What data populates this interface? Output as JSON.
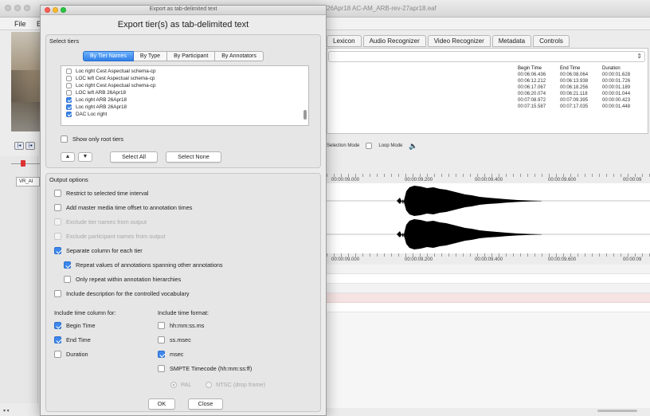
{
  "background_app": {
    "window_title": "26Apr18 AC-AM_ARB-rev-27apr18.eaf",
    "menu": {
      "file": "File",
      "edit": "E"
    },
    "tabs": [
      "Lexicon",
      "Audio Recognizer",
      "Video Recognizer",
      "Metadata",
      "Controls"
    ],
    "grid_headers": [
      "Begin Time",
      "End Time",
      "Duration"
    ],
    "grid_rows": [
      [
        "00:06:06.436",
        "00:06:08.064",
        "00:00:01.628"
      ],
      [
        "00:06:12.212",
        "00:06:13.938",
        "00:00:01.726"
      ],
      [
        "00:06:17.067",
        "00:06:18.256",
        "00:00:01.189"
      ],
      [
        "00:06:20.074",
        "00:06:21.118",
        "00:00:01.044"
      ],
      [
        "00:07:08.972",
        "00:07:09.395",
        "00:00:00.423"
      ],
      [
        "00:07:15.587",
        "00:07:17.035",
        "00:00:01.448"
      ]
    ],
    "selection_mode": "Selection Mode",
    "loop_mode": "Loop Mode",
    "tier_label": "VR_AI",
    "ruler_labels": [
      "00:00:09.000",
      "00:00:09.200",
      "00:00:09.400",
      "00:00:09.600",
      "00:00:09"
    ],
    "speaker_icon": "speaker-icon"
  },
  "dialog": {
    "window_title": "Export as tab-delimited text",
    "heading": "Export tier(s) as tab-delimited text",
    "select_tiers": {
      "title": "Select tiers",
      "tabs": [
        "By Tier Names",
        "By Type",
        "By Participant",
        "By Annotators"
      ],
      "active_tab": "By Tier Names",
      "tiers": [
        {
          "label": "Loc right Cest Aspectual schema-cp",
          "checked": false
        },
        {
          "label": "LOC left Cest Aspectual schema-cp",
          "checked": false
        },
        {
          "label": "Loc right Cest Aspectual schema-cp",
          "checked": false
        },
        {
          "label": "LOC left ARB 26Apr18",
          "checked": false
        },
        {
          "label": "Loc right ARB 26Apr18",
          "checked": true
        },
        {
          "label": "Loc right ARB 26Apr18",
          "checked": true
        },
        {
          "label": "DAC Loc right",
          "checked": true
        }
      ],
      "show_only_root_tiers": {
        "label": "Show only root tiers",
        "checked": false
      },
      "move_up": "▲",
      "move_down": "▼",
      "select_all": "Select All",
      "select_none": "Select None"
    },
    "output_options": {
      "title": "Output options",
      "options": [
        {
          "label": "Restrict to selected time interval",
          "checked": false,
          "enabled": true
        },
        {
          "label": "Add master media time offset to annotation times",
          "checked": false,
          "enabled": true
        },
        {
          "label": "Exclude tier names from output",
          "checked": false,
          "enabled": false
        },
        {
          "label": "Exclude participant names from output",
          "checked": false,
          "enabled": false
        },
        {
          "label": "Separate column for each tier",
          "checked": true,
          "enabled": true
        },
        {
          "label": "Repeat values of annotations spanning other annotations",
          "checked": true,
          "enabled": true
        },
        {
          "label": "Only repeat within annotation hierarchies",
          "checked": false,
          "enabled": true
        },
        {
          "label": "Include description for the controlled vocabulary",
          "checked": false,
          "enabled": true
        }
      ],
      "time_columns_title": "Include time column for:",
      "time_columns": [
        {
          "label": "Begin Time",
          "checked": true
        },
        {
          "label": "End Time",
          "checked": true
        },
        {
          "label": "Duration",
          "checked": false
        }
      ],
      "time_formats_title": "Include time format:",
      "time_formats": [
        {
          "label": "hh:mm:ss.ms",
          "checked": false
        },
        {
          "label": "ss.msec",
          "checked": false
        },
        {
          "label": "msec",
          "checked": true
        },
        {
          "label": "SMPTE Timecode (hh:mm:ss:ff)",
          "checked": false
        }
      ],
      "frame_rates": [
        {
          "label": "PAL",
          "selected": true
        },
        {
          "label": "NTSC (drop frame)",
          "selected": false
        }
      ]
    },
    "buttons": {
      "ok": "OK",
      "close": "Close"
    }
  },
  "colors": {
    "accent": "#3d87ec",
    "close_light": "#fc5f57",
    "minimize_light": "#fdbc2e",
    "zoom_light": "#28c840",
    "annotation_row": "#f6e3e3"
  }
}
